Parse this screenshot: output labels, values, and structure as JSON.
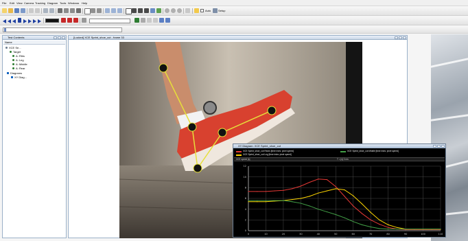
{
  "menu": [
    "File",
    "Edit",
    "View",
    "Camera",
    "Tracking",
    "Diagram",
    "Tools",
    "Windows",
    "Help"
  ],
  "toolbar": {
    "auto_label": "Auto",
    "setup_label": "Setup"
  },
  "tree_panel": {
    "title": "Test Contents",
    "column_header": "Name",
    "items": [
      {
        "label": "XCE Se...",
        "color": "#6a7a8c"
      },
      {
        "label": "Target",
        "color": "#2e7d32"
      },
      {
        "label": "A: Ribs",
        "color": "#2e7d32"
      },
      {
        "label": "A: Leg",
        "color": "#2e7d32"
      },
      {
        "label": "A: Middle",
        "color": "#2e7d32"
      },
      {
        "label": "A: Rear",
        "color": "#2e7d32"
      },
      {
        "label": "Diagrams",
        "color": "#1565c0"
      },
      {
        "label": "XY Diag...",
        "color": "#1565c0"
      }
    ]
  },
  "video_panel": {
    "title": "[Locked] XCE Sprint_shoe_cut - frame 33"
  },
  "xy_panel": {
    "title": "XY Diagram: XCE Sprint_shoe_cut",
    "legend": [
      {
        "label": "XCE Sprint_shoe_cut Rears [time intvs: pixel speed]",
        "color": "#e53935"
      },
      {
        "label": "XCE Sprint_shoe_cut Leg [time intvs: pixel speed]",
        "color": "#ffd600"
      },
      {
        "label": "XCE Sprint_shoe_cut Middle [time intvs: pixel speed]",
        "color": "#43a047"
      }
    ],
    "header_left": "XCE speed [s]",
    "header_right": "T = [s] 0 ms"
  },
  "colors": {
    "panel_border": "#9ab0c8",
    "plot_background": "#000000",
    "grid": "#4a4a4a"
  },
  "chart_data": {
    "type": "line",
    "title": "",
    "xlabel": "",
    "ylabel": "",
    "x": [
      0,
      5,
      10,
      15,
      20,
      25,
      30,
      35,
      40,
      45,
      50,
      55,
      60,
      65,
      70,
      75,
      80,
      85,
      90,
      95,
      100,
      105,
      110
    ],
    "xlim": [
      0,
      110
    ],
    "ylim": [
      0,
      12
    ],
    "x_ticks": [
      0,
      10,
      20,
      30,
      40,
      50,
      60,
      70,
      80,
      90,
      100,
      110
    ],
    "y_ticks": [
      0,
      2,
      4,
      6,
      8,
      10,
      12
    ],
    "grid": true,
    "series": [
      {
        "name": "XCE Sprint_shoe_cut Rears [time intvs: pixel speed]",
        "color": "#e53935",
        "values": [
          7.3,
          7.3,
          7.3,
          7.4,
          7.5,
          7.8,
          8.3,
          9.0,
          9.6,
          9.5,
          8.2,
          6.4,
          4.6,
          3.2,
          2.0,
          1.2,
          0.6,
          0.3,
          0.2,
          0.2,
          0.2,
          0.2,
          0.2
        ]
      },
      {
        "name": "XCE Sprint_shoe_cut Leg [time intvs: pixel speed]",
        "color": "#ffd600",
        "values": [
          5.4,
          5.4,
          5.4,
          5.5,
          5.6,
          5.8,
          6.0,
          6.4,
          7.0,
          7.4,
          7.8,
          7.6,
          6.5,
          5.0,
          3.4,
          2.0,
          1.1,
          0.6,
          0.3,
          0.3,
          0.3,
          0.3,
          0.3
        ]
      },
      {
        "name": "XCE Sprint_shoe_cut Middle [time intvs: pixel speed]",
        "color": "#43a047",
        "values": [
          5.6,
          5.6,
          5.6,
          5.6,
          5.6,
          5.4,
          5.1,
          4.6,
          4.0,
          3.5,
          3.0,
          2.4,
          1.7,
          1.1,
          0.7,
          0.4,
          0.3,
          0.3,
          0.3,
          0.3,
          0.3,
          0.3,
          0.3
        ]
      }
    ]
  }
}
